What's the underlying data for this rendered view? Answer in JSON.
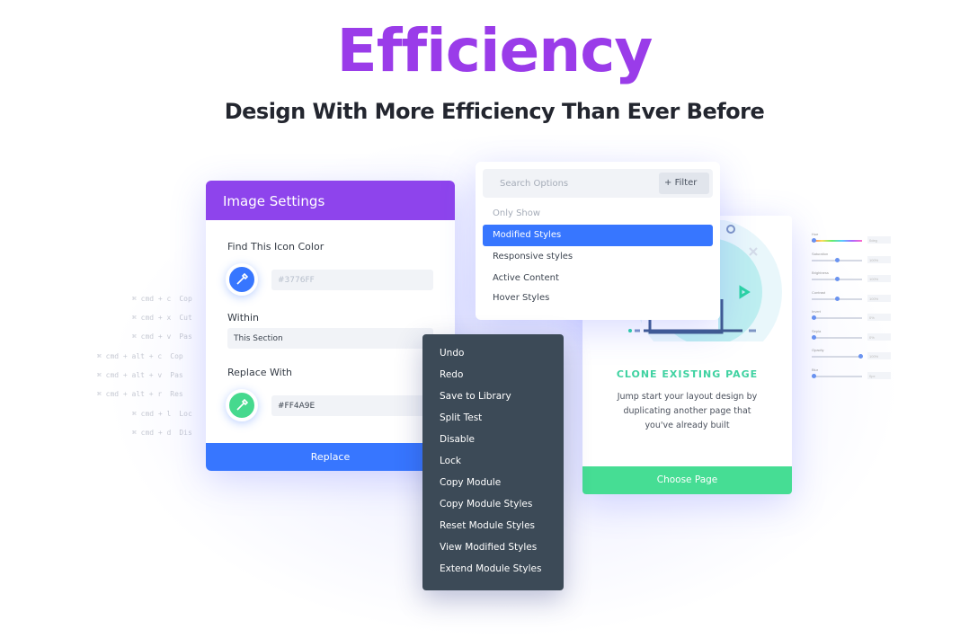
{
  "hero": {
    "title": "Efficiency",
    "subtitle": "Design With More Efficiency Than Ever Before"
  },
  "shortcuts": [
    {
      "keys": "⌘ cmd  +  c",
      "label": "Cop"
    },
    {
      "keys": "⌘ cmd  +  x",
      "label": "Cut"
    },
    {
      "keys": "⌘ cmd  +  v",
      "label": "Pas"
    },
    {
      "keys": "⌘ cmd  +  alt  +  c",
      "label": "Cop"
    },
    {
      "keys": "⌘ cmd  +  alt  +  v",
      "label": "Pas"
    },
    {
      "keys": "⌘ cmd  +  alt  +  r",
      "label": "Res"
    },
    {
      "keys": "⌘ cmd  +  l",
      "label": "Loc"
    },
    {
      "keys": "⌘ cmd  +  d",
      "label": "Dis"
    }
  ],
  "filters": [
    {
      "label": "Hue",
      "value": "0deg",
      "level": 0
    },
    {
      "label": "Saturation",
      "value": "100%",
      "level": 0.5
    },
    {
      "label": "Brightness",
      "value": "100%",
      "level": 0.5
    },
    {
      "label": "Contrast",
      "value": "100%",
      "level": 0.5
    },
    {
      "label": "Invert",
      "value": "0%",
      "level": 0
    },
    {
      "label": "Sepia",
      "value": "0%",
      "level": 0
    },
    {
      "label": "Opacity",
      "value": "100%",
      "level": 1
    },
    {
      "label": "Blur",
      "value": "0px",
      "level": 0
    }
  ],
  "image_settings": {
    "title": "Image Settings",
    "find_label": "Find This Icon Color",
    "find_value": "#3776FF",
    "within_label": "Within",
    "within_value": "This Section",
    "replace_label": "Replace With",
    "replace_value": "#FF4A9E",
    "replace_button": "Replace",
    "colors": {
      "header": "#8E44EC",
      "find": "#3776FF",
      "replace": "#46D98E"
    }
  },
  "search_panel": {
    "placeholder": "Search Options",
    "filter_label": "Filter",
    "heading": "Only Show",
    "options": [
      "Modified Styles",
      "Responsive styles",
      "Active Content",
      "Hover Styles"
    ],
    "selected": "Modified Styles"
  },
  "context_menu": [
    "Undo",
    "Redo",
    "Save to Library",
    "Split Test",
    "Disable",
    "Lock",
    "Copy Module",
    "Copy Module Styles",
    "Reset Module Styles",
    "View Modified Styles",
    "Extend Module Styles"
  ],
  "clone_card": {
    "title": "CLONE EXISTING PAGE",
    "description": "Jump start your layout design by duplicating another page that you've already built",
    "button": "Choose Page"
  }
}
